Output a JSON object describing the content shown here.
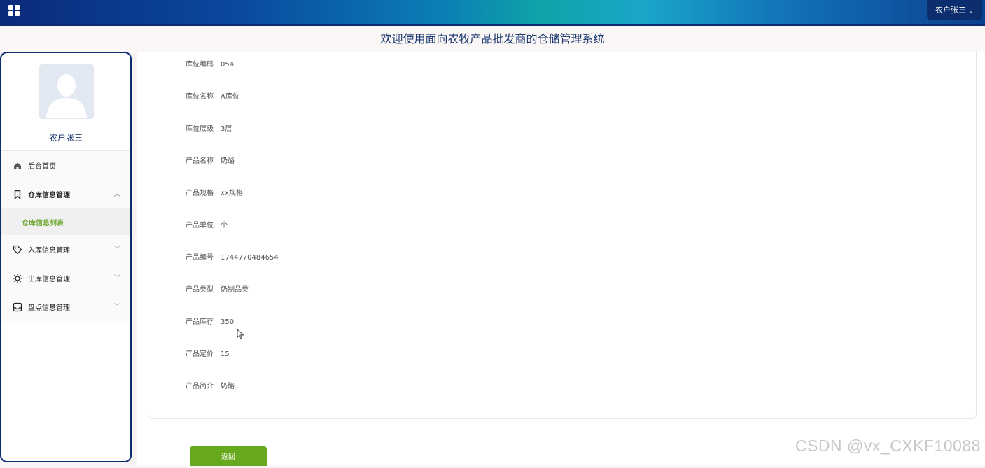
{
  "header": {
    "user_menu_label": "农户张三",
    "system_title": "欢迎使用面向农牧产品批发商的仓储管理系统",
    "accent_color": "#0c2e6e"
  },
  "sidebar": {
    "username": "农户张三",
    "items": [
      {
        "label": "后台首页",
        "icon": "home-icon"
      },
      {
        "label": "仓库信息管理",
        "icon": "bookmark-icon",
        "expanded": true
      },
      {
        "label": "入库信息管理",
        "icon": "tag-icon"
      },
      {
        "label": "出库信息管理",
        "icon": "sun-icon"
      },
      {
        "label": "盘点信息管理",
        "icon": "inbox-icon"
      }
    ],
    "active_subitem": "仓库信息列表",
    "active_color": "#6aa52a"
  },
  "detail": {
    "fields": [
      {
        "label": "库位编码",
        "value": "054"
      },
      {
        "label": "库位名称",
        "value": "A库位"
      },
      {
        "label": "库位层级",
        "value": "3层"
      },
      {
        "label": "产品名称",
        "value": "奶酪"
      },
      {
        "label": "产品规格",
        "value": "xx规格"
      },
      {
        "label": "产品单位",
        "value": "个"
      },
      {
        "label": "产品编号",
        "value": "1744770484654"
      },
      {
        "label": "产品类型",
        "value": "奶制品类"
      },
      {
        "label": "产品库存",
        "value": "350"
      },
      {
        "label": "产品定价",
        "value": "15"
      },
      {
        "label": "产品简介",
        "value": "奶酪.."
      }
    ]
  },
  "actions": {
    "back_label": "返回",
    "back_color": "#67a91c"
  },
  "watermark": "CSDN @vx_CXKF10088"
}
